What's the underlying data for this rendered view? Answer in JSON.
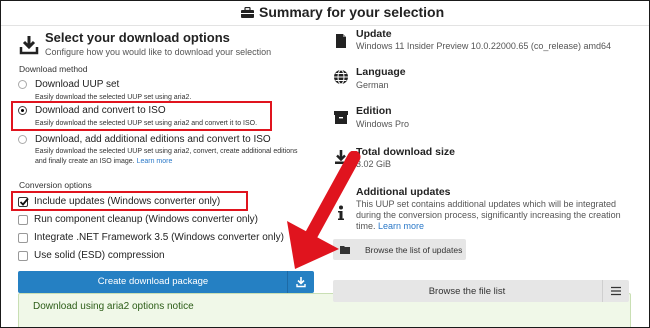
{
  "header": {
    "title": "Summary for your selection",
    "icon": "briefcase-icon"
  },
  "left": {
    "title": "Select your download options",
    "subtitle": "Configure how you would like to download your selection",
    "download_method_label": "Download method",
    "methods": [
      {
        "title": "Download UUP set",
        "desc": "Easily download the selected UUP set using aria2.",
        "selected": false
      },
      {
        "title": "Download and convert to ISO",
        "desc": "Easily download the selected UUP set using aria2 and convert it to ISO.",
        "selected": true
      },
      {
        "title": "Download, add additional editions and convert to ISO",
        "desc1": "Easily download the selected UUP set using aria2, convert, create additional editions",
        "desc2": "and finally create an ISO image.",
        "learn_more": "Learn more",
        "selected": false
      }
    ],
    "conversion_label": "Conversion options",
    "conversions": [
      {
        "label": "Include updates (Windows converter only)",
        "checked": true
      },
      {
        "label": "Run component cleanup (Windows converter only)",
        "checked": false
      },
      {
        "label": "Integrate .NET Framework 3.5 (Windows converter only)",
        "checked": false
      },
      {
        "label": "Use solid (ESD) compression",
        "checked": false
      }
    ],
    "create_button": "Create download package",
    "notice": "Download using aria2 options notice"
  },
  "right": {
    "update": {
      "title": "Update",
      "value": "Windows 11 Insider Preview 10.0.22000.65 (co_release) amd64"
    },
    "language": {
      "title": "Language",
      "value": "German"
    },
    "edition": {
      "title": "Edition",
      "value": "Windows Pro"
    },
    "size": {
      "title": "Total download size",
      "value": "3.02 GiB"
    },
    "additional": {
      "title": "Additional updates",
      "line1": "This UUP set contains additional updates which will be integrated",
      "line2": "during the conversion process, significantly increasing the creation",
      "line3": "time.",
      "learn_more": "Learn more"
    },
    "browse_updates": "Browse the list of updates",
    "browse_files": "Browse the file list"
  },
  "colors": {
    "accent": "#2580c3",
    "highlight": "#e0141e",
    "notice_bg": "#f0f8e8"
  }
}
